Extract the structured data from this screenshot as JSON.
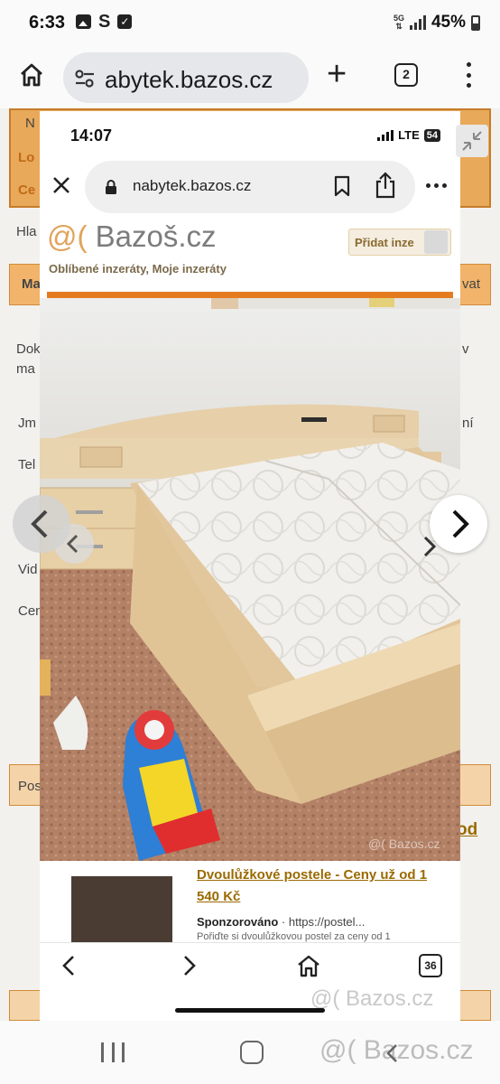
{
  "status_bar": {
    "time": "6:33",
    "s_icon_text": "S",
    "network": "5G",
    "battery": "45%"
  },
  "browser": {
    "url": "abytek.bazos.cz",
    "tabs_count": "2"
  },
  "background_page": {
    "frag_n": "N",
    "frag_lo": "Lo",
    "frag_ce": "Ce",
    "frag_hla": "Hla",
    "frag_ma": "Ma",
    "frag_vat": "vat",
    "frag_dok": "Dok",
    "frag_ma2": "ma",
    "frag_jm": "Jm",
    "frag_tel": "Tel",
    "frag_vid": "Vid",
    "frag_cen": "Cen",
    "frag_pos": "Pos",
    "frag_od": "od",
    "frag_v": "v",
    "frag_ni": "ní"
  },
  "screenshot": {
    "status_time": "14:07",
    "network": "LTE",
    "battery": "54",
    "url": "nabytek.bazos.cz",
    "logo_at": "@(",
    "logo_name": "Bazoš.cz",
    "favorites": "Oblíbené inzeráty, Moje inzeráty",
    "add_button": "Přidat inze",
    "photo_watermark": "@( Bazos.cz",
    "ad_title": "Dvoulůžkové postele - Ceny už od 1 540 Kč",
    "ad_sponsored": "Sponzorováno",
    "ad_url": "https://postel...",
    "ad_description": "Pořiďte si dvoulůžkovou postel za ceny od 1",
    "tabs_count": "36",
    "bottom_watermark": "@( Bazos.cz"
  },
  "system_nav": {
    "watermark": "@( Bazos.cz"
  },
  "colors": {
    "bazos_orange": "#e47c1f",
    "link_brown": "#9a6a00"
  }
}
